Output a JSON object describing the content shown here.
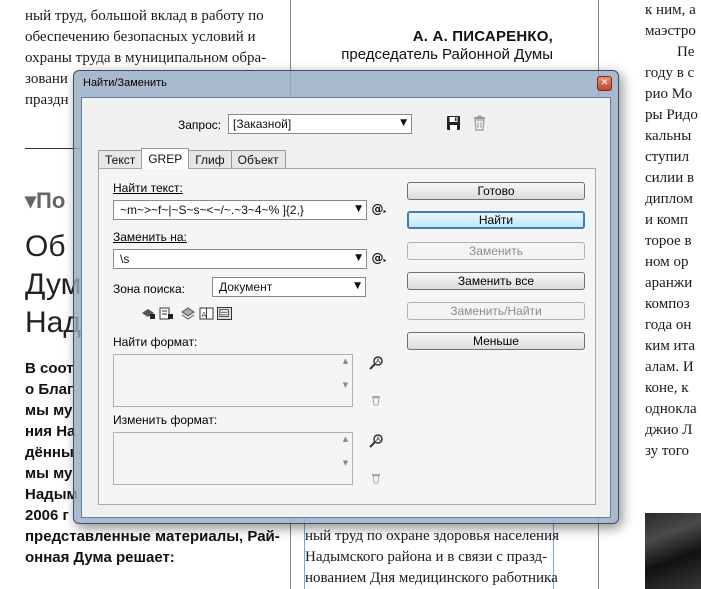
{
  "newspaper": {
    "col1_lines": [
      "ный труд, большой вклад в работу по",
      "обеспечению безопасных условий и",
      "охраны труда в муниципальном обра-",
      "зовани",
      "праздн"
    ],
    "signature_name": "А. А. ПИСАРЕНКО,",
    "signature_role_1": "председатель Районной Думы",
    "col3_lines": [
      "к ним, а",
      "маэстро",
      "Пе",
      "году в с",
      "рио Мо",
      "ры Ридо",
      "кальны",
      "ступил",
      "силии в",
      "диплом",
      "и комп",
      "торое в",
      "ном ор",
      "аранжи",
      "композ",
      "года он",
      "ким ита",
      "алам. И",
      "коне, к",
      "однокла",
      "джио Л",
      "зу того"
    ],
    "section_tag": "▾По",
    "headline_lines": [
      "Об",
      "Дум",
      "Над"
    ],
    "lead_lines": [
      "В соот",
      "о Благ",
      "мы му",
      "ния На",
      "дённы",
      "мы му",
      "Надым",
      "2006 г",
      "представленные материалы, Рай-",
      "онная Дума решает:"
    ],
    "bottom_lines": [
      "ный труд по охране здоровья населения",
      "Надымского района и в связи с празд-",
      "нованием Дня медицинского работника"
    ]
  },
  "dialog": {
    "title": "Найти/Заменить",
    "close_symbol": "✕",
    "query_label": "Запрос:",
    "query_value": "[Заказной]",
    "tabs": [
      "Текст",
      "GREP",
      "Глиф",
      "Объект"
    ],
    "active_tab": "GREP",
    "find_label": "Найти текст:",
    "find_value": "~m~>~f~|~S~s~<~/~.~3~4~% ]{2,}",
    "replace_label": "Заменить на:",
    "replace_value": "\\s",
    "zone_label": "Зона поиска:",
    "zone_value": "Документ",
    "find_format_label": "Найти формат:",
    "change_format_label": "Изменить формат:",
    "special_char_symbol": "@",
    "buttons": {
      "done": "Готово",
      "find": "Найти",
      "replace": "Заменить",
      "replace_all": "Заменить все",
      "replace_find": "Заменить/Найти",
      "less": "Меньше"
    }
  }
}
